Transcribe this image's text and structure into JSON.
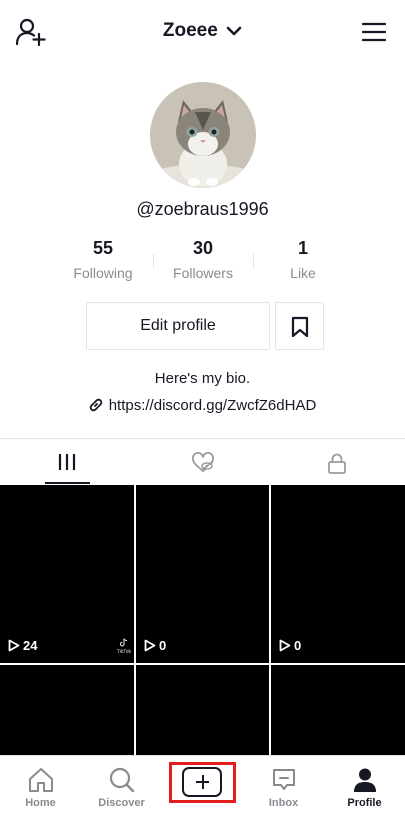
{
  "header": {
    "account_name": "Zoeee",
    "add_user_icon": "add-user-icon",
    "menu_icon": "hamburger-menu-icon",
    "dropdown_icon": "chevron-down-icon"
  },
  "profile": {
    "username": "@zoebraus1996",
    "avatar_icon": "kitten-photo",
    "stats": [
      {
        "value": "55",
        "label": "Following"
      },
      {
        "value": "30",
        "label": "Followers"
      },
      {
        "value": "1",
        "label": "Like"
      }
    ],
    "edit_label": "Edit profile",
    "bio": "Here's my bio.",
    "link": "https://discord.gg/ZwcfZ6dHAD"
  },
  "tabs": [
    {
      "name": "videos",
      "icon": "grid-icon",
      "active": true
    },
    {
      "name": "liked",
      "icon": "hidden-heart-icon",
      "active": false
    },
    {
      "name": "private",
      "icon": "lock-icon",
      "active": false
    }
  ],
  "videos": [
    {
      "views": "24",
      "watermark": "TikTok"
    },
    {
      "views": "0"
    },
    {
      "views": "0"
    },
    {},
    {},
    {}
  ],
  "bottom_nav": [
    {
      "label": "Home",
      "icon": "home-icon"
    },
    {
      "label": "Discover",
      "icon": "search-icon"
    },
    {
      "label": "",
      "icon": "create-plus-icon"
    },
    {
      "label": "Inbox",
      "icon": "inbox-icon"
    },
    {
      "label": "Profile",
      "icon": "profile-icon",
      "active": true
    }
  ],
  "colors": {
    "text": "#161823",
    "secondary_text": "#8a8b91",
    "border": "#e3e3e4",
    "highlight": "#e11d1d"
  }
}
